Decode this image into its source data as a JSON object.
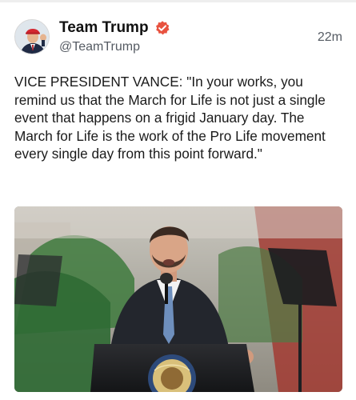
{
  "post": {
    "author": {
      "display_name": "Team Trump",
      "handle": "@TeamTrump",
      "avatar_icon": "avatar-image",
      "verified_icon": "verified-badge-icon",
      "verified_color": "#e8523f"
    },
    "timestamp": "22m",
    "text": "VICE PRESIDENT VANCE: \"In your works, you remind us that the March for Life is not just a single event that happens on a frigid January day. The March for Life is the work of the Pro Life movement every single day from this point forward.\"",
    "media": {
      "kind": "photo",
      "seal_text": "SEAL OF THE UNITED STATES"
    }
  }
}
